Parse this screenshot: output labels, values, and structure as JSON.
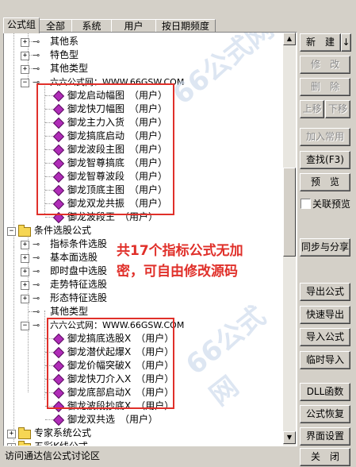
{
  "tabs": [
    {
      "label": "公式组",
      "active": true
    },
    {
      "label": "全部",
      "active": false
    },
    {
      "label": "系统",
      "active": false
    },
    {
      "label": "用户",
      "active": false
    },
    {
      "label": "按日期频度",
      "active": false
    }
  ],
  "tree": {
    "top_items": [
      "其他系",
      "特色型",
      "其他类型"
    ],
    "group1_title": "六六公式网：WWW.66GSW.COM",
    "group1_formulas": [
      "御龙启动幅图　（用户）",
      "御龙快刀幅图　（用户）",
      "御龙主力入货　（用户）",
      "御龙搞底启动　（用户）",
      "御龙波段主图　（用户）",
      "御龙智尊搞底　（用户）",
      "御龙智尊波段　（用户）",
      "御龙顶底主图　（用户）",
      "御龙双龙共振　（用户）",
      "御龙波段王　（用户）"
    ],
    "folder_condition": "条件选股公式",
    "condition_items": [
      "指标条件选股",
      "基本面选股",
      "即时盘中选股",
      "走势特征选股",
      "形态特征选股",
      "其他类型"
    ],
    "group2_title": "六六公式网：WWW.66GSW.COM",
    "group2_formulas": [
      "御龙搞底选股X　（用户）",
      "御龙潜伏起爆X　（用户）",
      "御龙价幅突破X　（用户）",
      "御龙快刀介入X　（用户）",
      "御龙底部启动X　（用户）",
      "御龙波段抄底X　（用户）",
      "御龙双共选　（用户）"
    ],
    "folder_expert": "专家系统公式",
    "folder_color": "五彩K线公式"
  },
  "overlay_text": {
    "line1": "共17个指标公式无加",
    "line2": "密，可自由修改源码"
  },
  "watermark": "66公式网",
  "buttons": {
    "new": "新　建",
    "new_arrow": "↓",
    "modify": "修　改",
    "delete": "删　除",
    "move_up": "上移",
    "move_down": "下移",
    "add_common": "加入常用",
    "find": "查找(F3)",
    "preview": "预　览",
    "link_preview": "关联预览",
    "sync_share": "同步与分享",
    "export": "导出公式",
    "quick_export": "快速导出",
    "import": "导入公式",
    "temp_import": "临时导入",
    "dll": "DLL函数",
    "restore": "公式恢复",
    "ui_settings": "界面设置",
    "close": "关　闭"
  },
  "status_text": "访问通达信公式讨论区"
}
